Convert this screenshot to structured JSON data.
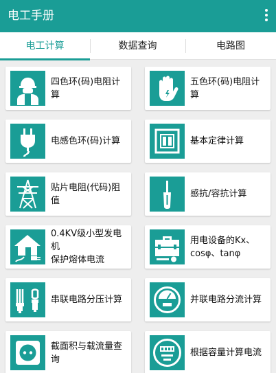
{
  "app": {
    "title": "电工手册"
  },
  "tabs": [
    {
      "label": "电工计算",
      "active": true
    },
    {
      "label": "数据查询",
      "active": false
    },
    {
      "label": "电路图",
      "active": false
    }
  ],
  "cards": [
    {
      "label": "四色环(码)电阻计算",
      "icon": "electrician-worker-icon"
    },
    {
      "label": "五色环(码)电阻计算",
      "icon": "insulated-glove-icon"
    },
    {
      "label": "电感色环(码)计算",
      "icon": "plug-icon"
    },
    {
      "label": "基本定律计算",
      "icon": "wall-switch-icon"
    },
    {
      "label": "贴片电阻(代码)阻值",
      "icon": "power-tower-icon"
    },
    {
      "label": "感抗/容抗计算",
      "icon": "screwdriver-icon"
    },
    {
      "label": "0.4KV级小型发电机\n保护熔体电流",
      "icon": "house-plug-icon"
    },
    {
      "label": "用电设备的Kx、\ncosφ、tanφ",
      "icon": "toolbox-icon"
    },
    {
      "label": "串联电路分压计算",
      "icon": "energy-saving-bulb-icon"
    },
    {
      "label": "并联电路分流计算",
      "icon": "meter-gauge-icon"
    },
    {
      "label": "截面积与载流量查询",
      "icon": "wall-socket-icon"
    },
    {
      "label": "根据容量计算电流",
      "icon": "electric-meter-icon"
    }
  ],
  "colors": {
    "primary": "#1a9d96",
    "background": "#eeeeee"
  }
}
